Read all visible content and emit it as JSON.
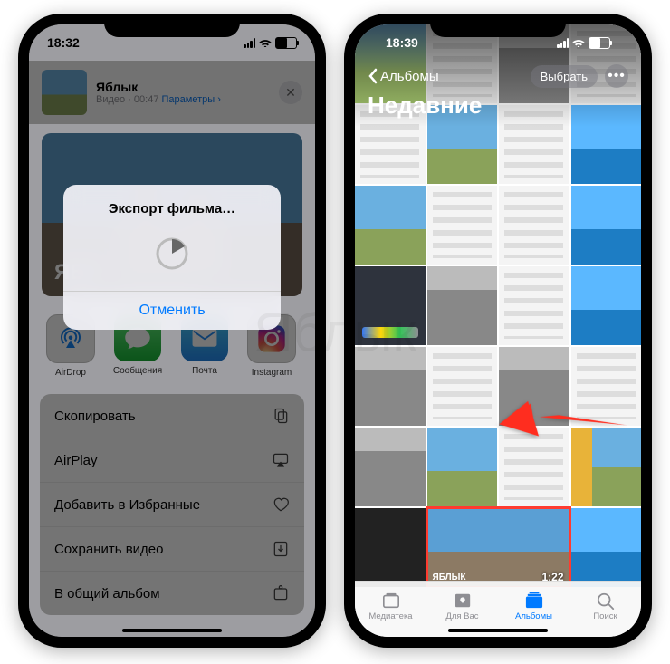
{
  "phone1": {
    "time": "18:32",
    "share": {
      "title": "Яблык",
      "meta_type": "Видео",
      "meta_duration": "00:47",
      "meta_params": "Параметры",
      "big_label": "ЯБЛ",
      "modal_title": "Экспорт фильма…",
      "modal_cancel": "Отменить"
    },
    "apps": [
      {
        "name": "AirDrop"
      },
      {
        "name": "Сообщения"
      },
      {
        "name": "Почта"
      },
      {
        "name": "Instagram"
      }
    ],
    "actions": [
      {
        "label": "Скопировать",
        "icon": "copy"
      },
      {
        "label": "AirPlay",
        "icon": "airplay"
      },
      {
        "label": "Добавить в Избранные",
        "icon": "heart"
      },
      {
        "label": "Сохранить видео",
        "icon": "download"
      },
      {
        "label": "В общий альбом",
        "icon": "shared-album"
      }
    ]
  },
  "phone2": {
    "time": "18:39",
    "back_label": "Альбомы",
    "select_label": "Выбрать",
    "title": "Недавние",
    "video_duration": "1:22",
    "video_badge": "ЯБЛЫК",
    "tabs": [
      {
        "label": "Медиатека"
      },
      {
        "label": "Для Вас"
      },
      {
        "label": "Альбомы"
      },
      {
        "label": "Поиск"
      }
    ]
  },
  "watermark": "Яблык"
}
